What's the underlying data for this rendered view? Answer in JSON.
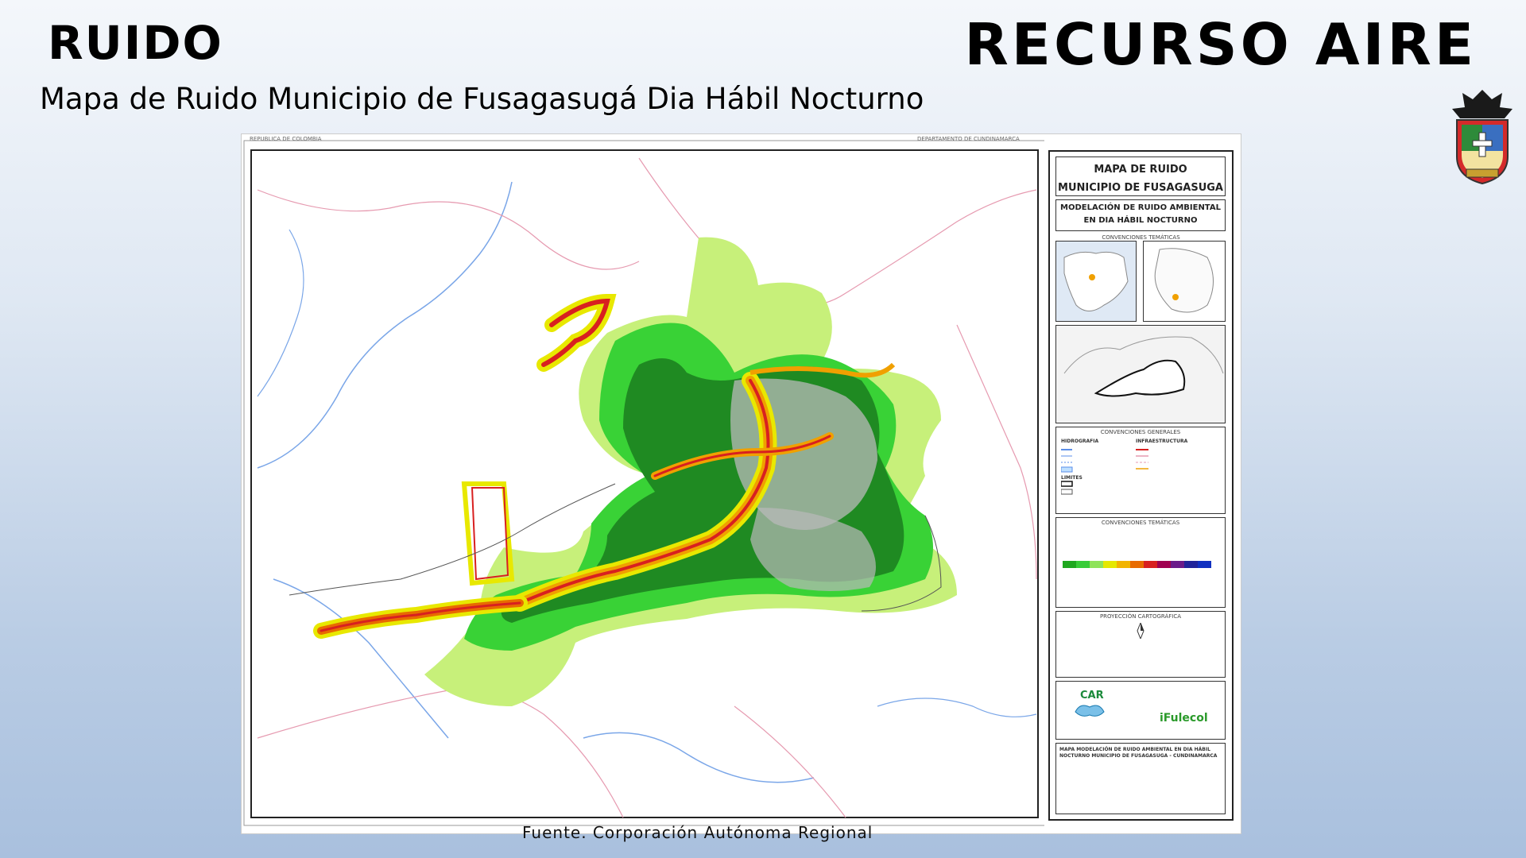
{
  "header": {
    "left_title": "RUIDO",
    "right_title": "RECURSO AIRE",
    "subtitle": "Mapa de Ruido Municipio de Fusagasugá Dia Hábil Nocturno"
  },
  "source_note": "Fuente. Corporación Autónoma Regional",
  "legend": {
    "title_line1": "MAPA DE RUIDO",
    "title_line2": "MUNICIPIO DE FUSAGASUGA",
    "subtitle_line1": "MODELACIÓN DE RUIDO AMBIENTAL",
    "subtitle_line2": "EN DIA HÁBIL NOCTURNO",
    "conv_tematicas": "CONVENCIONES TEMÁTICAS",
    "conv_generales": "CONVENCIONES GENERALES",
    "hidrografia": "HIDROGRAFIA",
    "infraestructura": "INFRAESTRUCTURA",
    "limites": "LIMITES",
    "proyeccion": "PROYECCIÓN CARTOGRÁFICA",
    "logo_left": "CAR",
    "logo_right": "iFulecol",
    "footer_text": "MAPA MODELACIÓN DE RUIDO AMBIENTAL EN DIA HÁBIL NOCTURNO MUNICIPIO DE FUSAGASUGA - CUNDINAMARCA",
    "noise_colors": [
      "#1fa81f",
      "#38cc38",
      "#8fe35a",
      "#e5e800",
      "#f2b400",
      "#e86b00",
      "#d82020",
      "#a00050",
      "#6a1a8a",
      "#20249a",
      "#1030c0"
    ]
  },
  "map": {
    "top_left_label": "REPUBLICA DE COLOMBIA",
    "top_right_label": "DEPARTAMENTO DE CUNDINAMARCA"
  }
}
